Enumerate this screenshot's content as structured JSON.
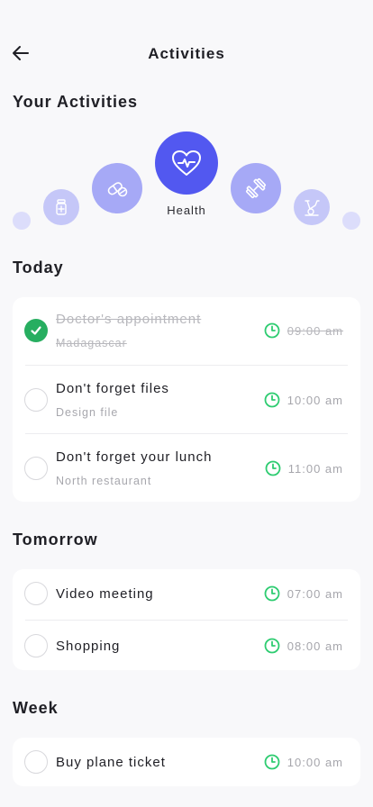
{
  "header": {
    "title": "Activities"
  },
  "activities_section": {
    "title": "Your Activities",
    "selected_label": "Health",
    "items": [
      {
        "name": "dot-left",
        "icon": "dot"
      },
      {
        "name": "medicine",
        "icon": "medicine-bottle-icon"
      },
      {
        "name": "pills",
        "icon": "pills-icon"
      },
      {
        "name": "health",
        "icon": "heart-pulse-icon"
      },
      {
        "name": "fitness",
        "icon": "dumbbell-icon"
      },
      {
        "name": "bike",
        "icon": "exercise-bike-icon"
      },
      {
        "name": "dot-right",
        "icon": "dot"
      }
    ]
  },
  "today": {
    "title": "Today",
    "tasks": [
      {
        "title": "Doctor's appointment",
        "subtitle": "Madagascar",
        "time": "09:00 am",
        "done": true
      },
      {
        "title": "Don't forget files",
        "subtitle": "Design file",
        "time": "10:00 am",
        "done": false
      },
      {
        "title": "Don't forget your lunch",
        "subtitle": "North restaurant",
        "time": "11:00 am",
        "done": false
      }
    ]
  },
  "tomorrow": {
    "title": "Tomorrow",
    "tasks": [
      {
        "title": "Video meeting",
        "time": "07:00 am",
        "done": false
      },
      {
        "title": "Shopping",
        "time": "08:00 am",
        "done": false
      }
    ]
  },
  "week": {
    "title": "Week",
    "tasks": [
      {
        "title": "Buy plane ticket",
        "time": "10:00 am",
        "done": false
      }
    ]
  },
  "colors": {
    "accent": "#5258f0",
    "accent_light": "#a6a9f6",
    "accent_pale": "#c5c7f8",
    "accent_faint": "#dcddfb",
    "success": "#27ae60",
    "clock": "#2ecc71"
  }
}
